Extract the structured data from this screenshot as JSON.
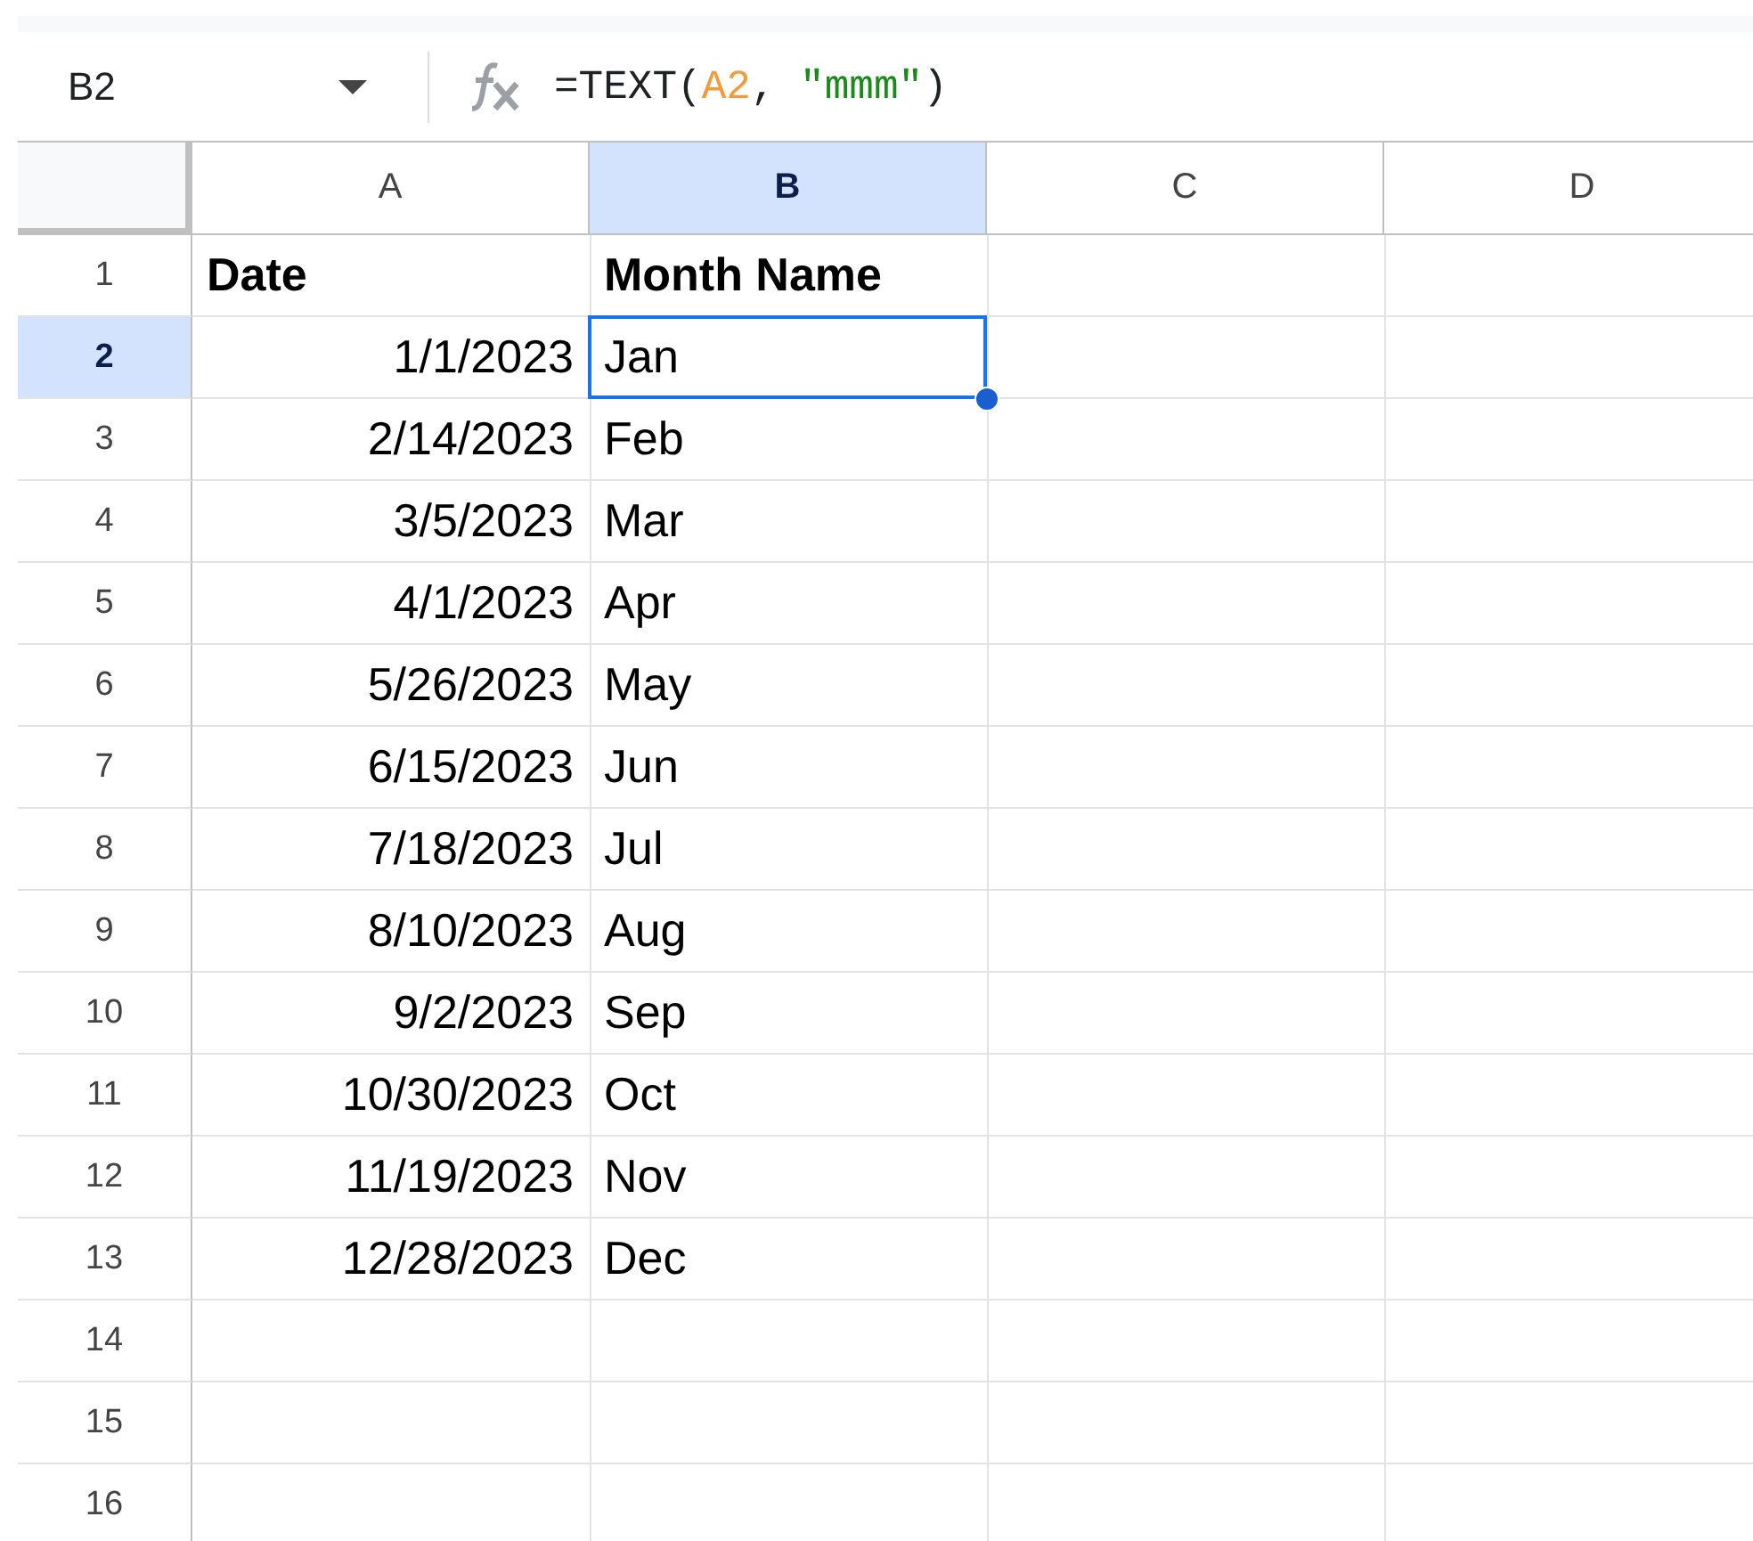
{
  "name_box": {
    "value": "B2"
  },
  "formula": [
    {
      "kind": "plain",
      "text": "=TEXT("
    },
    {
      "kind": "ref",
      "text": "A2"
    },
    {
      "kind": "plain",
      "text": ", "
    },
    {
      "kind": "string",
      "text": "\"mmm\""
    },
    {
      "kind": "plain",
      "text": ")"
    }
  ],
  "columns": [
    {
      "label": "A",
      "selected": false
    },
    {
      "label": "B",
      "selected": true
    },
    {
      "label": "C",
      "selected": false
    },
    {
      "label": "D",
      "selected": false
    }
  ],
  "rows": [
    {
      "number": "1",
      "selected": false,
      "cells": [
        {
          "text": "Date",
          "kind": "header",
          "selected": false
        },
        {
          "text": "Month Name",
          "kind": "header",
          "selected": false
        }
      ]
    },
    {
      "number": "2",
      "selected": true,
      "cells": [
        {
          "text": "1/1/2023",
          "kind": "date",
          "selected": false
        },
        {
          "text": "Jan",
          "kind": "text",
          "selected": true
        }
      ]
    },
    {
      "number": "3",
      "selected": false,
      "cells": [
        {
          "text": "2/14/2023",
          "kind": "date",
          "selected": false
        },
        {
          "text": "Feb",
          "kind": "text",
          "selected": false
        }
      ]
    },
    {
      "number": "4",
      "selected": false,
      "cells": [
        {
          "text": "3/5/2023",
          "kind": "date",
          "selected": false
        },
        {
          "text": "Mar",
          "kind": "text",
          "selected": false
        }
      ]
    },
    {
      "number": "5",
      "selected": false,
      "cells": [
        {
          "text": "4/1/2023",
          "kind": "date",
          "selected": false
        },
        {
          "text": "Apr",
          "kind": "text",
          "selected": false
        }
      ]
    },
    {
      "number": "6",
      "selected": false,
      "cells": [
        {
          "text": "5/26/2023",
          "kind": "date",
          "selected": false
        },
        {
          "text": "May",
          "kind": "text",
          "selected": false
        }
      ]
    },
    {
      "number": "7",
      "selected": false,
      "cells": [
        {
          "text": "6/15/2023",
          "kind": "date",
          "selected": false
        },
        {
          "text": "Jun",
          "kind": "text",
          "selected": false
        }
      ]
    },
    {
      "number": "8",
      "selected": false,
      "cells": [
        {
          "text": "7/18/2023",
          "kind": "date",
          "selected": false
        },
        {
          "text": "Jul",
          "kind": "text",
          "selected": false
        }
      ]
    },
    {
      "number": "9",
      "selected": false,
      "cells": [
        {
          "text": "8/10/2023",
          "kind": "date",
          "selected": false
        },
        {
          "text": "Aug",
          "kind": "text",
          "selected": false
        }
      ]
    },
    {
      "number": "10",
      "selected": false,
      "cells": [
        {
          "text": "9/2/2023",
          "kind": "date",
          "selected": false
        },
        {
          "text": "Sep",
          "kind": "text",
          "selected": false
        }
      ]
    },
    {
      "number": "11",
      "selected": false,
      "cells": [
        {
          "text": "10/30/2023",
          "kind": "date",
          "selected": false
        },
        {
          "text": "Oct",
          "kind": "text",
          "selected": false
        }
      ]
    },
    {
      "number": "12",
      "selected": false,
      "cells": [
        {
          "text": "11/19/2023",
          "kind": "date",
          "selected": false
        },
        {
          "text": "Nov",
          "kind": "text",
          "selected": false
        }
      ]
    },
    {
      "number": "13",
      "selected": false,
      "cells": [
        {
          "text": "12/28/2023",
          "kind": "date",
          "selected": false
        },
        {
          "text": "Dec",
          "kind": "text",
          "selected": false
        }
      ]
    },
    {
      "number": "14",
      "selected": false,
      "cells": []
    },
    {
      "number": "15",
      "selected": false,
      "cells": []
    },
    {
      "number": "16",
      "selected": false,
      "cells": []
    }
  ]
}
